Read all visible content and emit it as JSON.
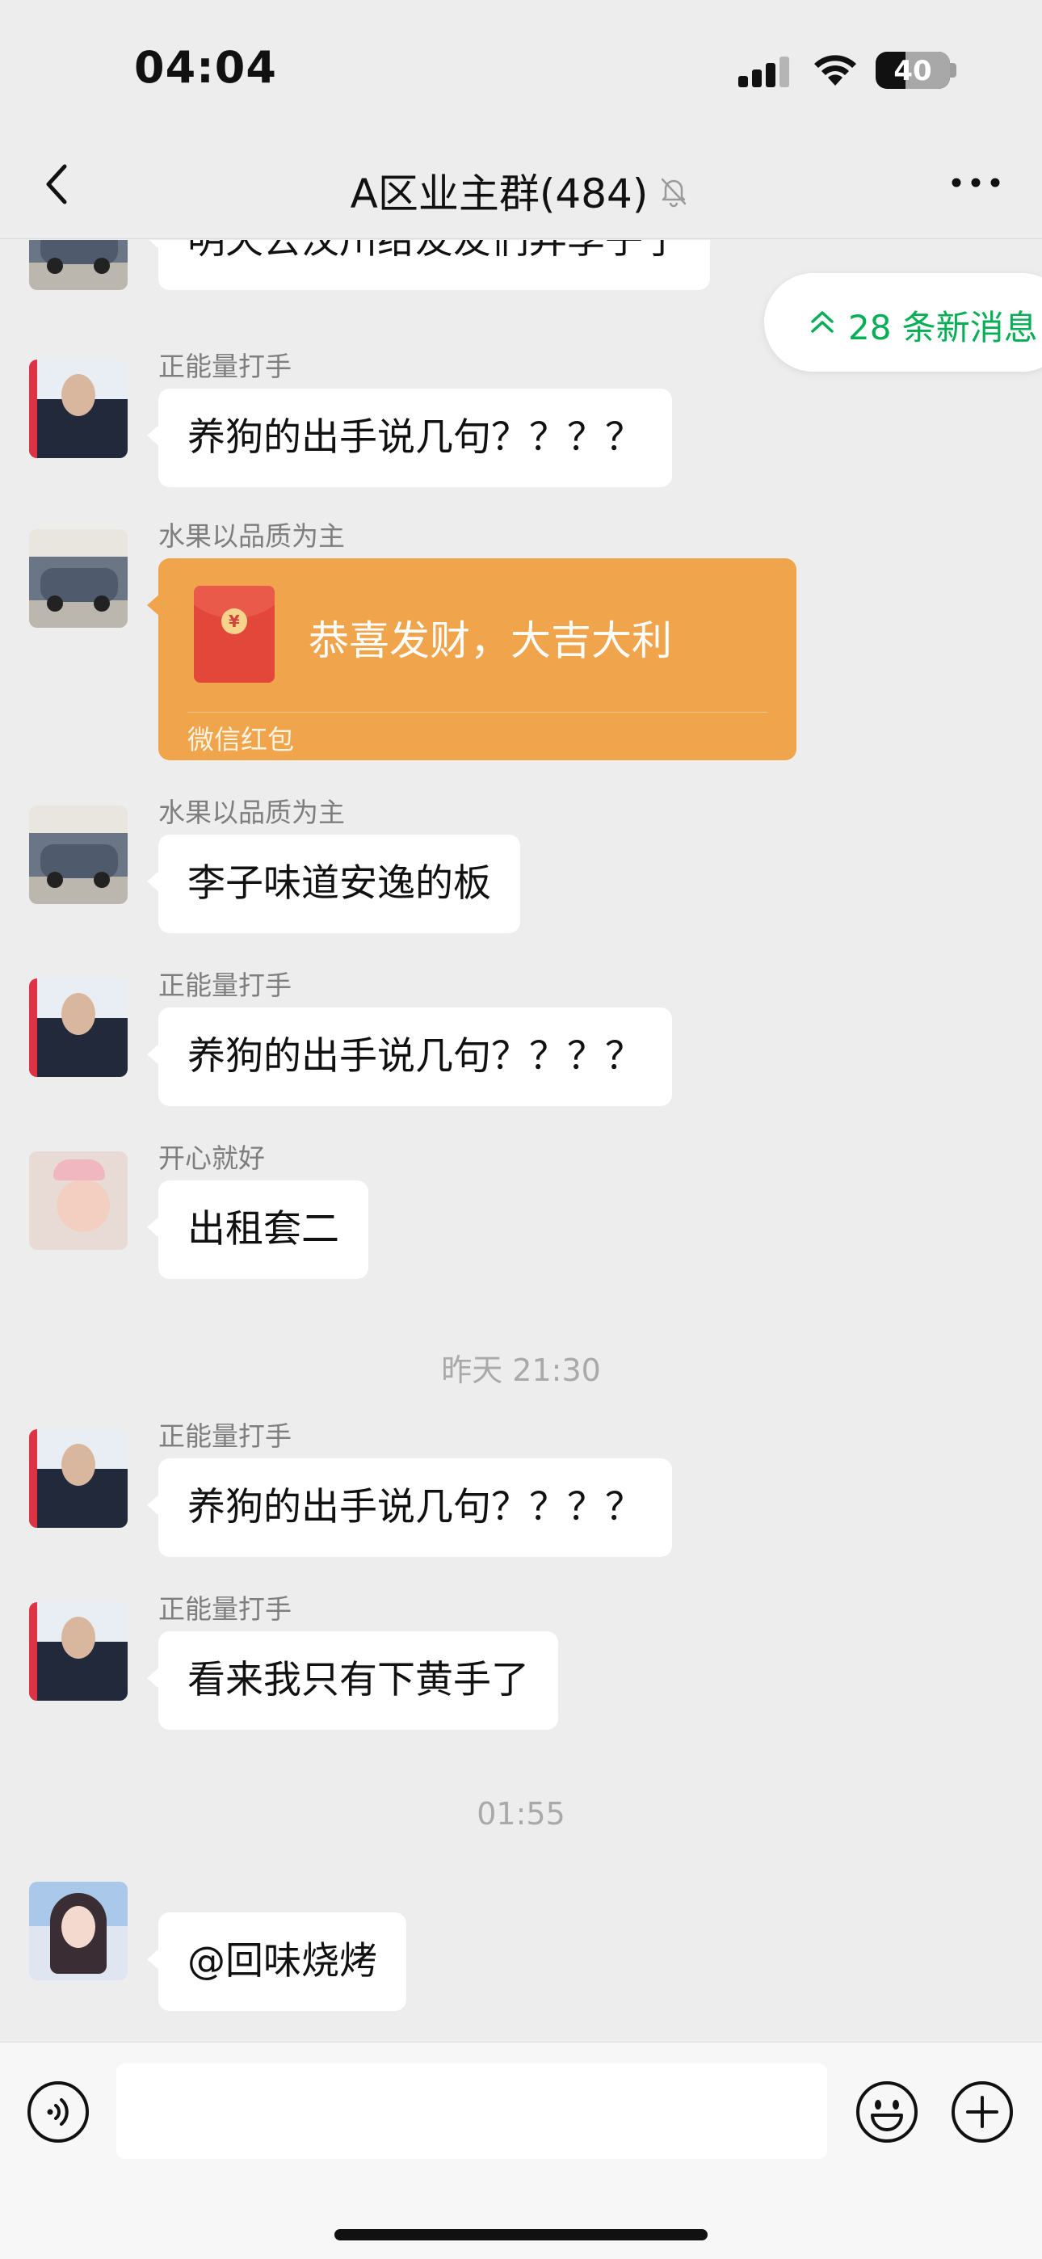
{
  "status_bar": {
    "time": "04:04",
    "battery_level": "40",
    "battery_fraction": 0.4
  },
  "nav": {
    "title": "A区业主群(484)",
    "back_icon": "chevron-left-icon",
    "mute_icon": "bell-slash-icon",
    "more_icon": "more-dots-icon"
  },
  "new_messages": {
    "label": "28 条新消息",
    "icon": "double-chevron-up-icon",
    "color": "#06ae56"
  },
  "messages": [
    {
      "type": "text",
      "sender": "",
      "avatar": "car-photo",
      "text": "明天去汶川给友友们弄李子了"
    },
    {
      "type": "text",
      "sender": "正能量打手",
      "avatar": "man-portrait",
      "text": "养狗的出手说几句？？？？"
    },
    {
      "type": "red_packet",
      "sender": "水果以品质为主",
      "avatar": "car-photo",
      "title": "恭喜发财，大吉大利",
      "label": "微信红包",
      "color": "#f0a44c"
    },
    {
      "type": "text",
      "sender": "水果以品质为主",
      "avatar": "car-photo",
      "text": "李子味道安逸的板"
    },
    {
      "type": "text",
      "sender": "正能量打手",
      "avatar": "man-portrait",
      "text": "养狗的出手说几句？？？？"
    },
    {
      "type": "text",
      "sender": "开心就好",
      "avatar": "baby-photo",
      "text": "出租套二"
    },
    {
      "type": "timestamp",
      "text": "昨天 21:30"
    },
    {
      "type": "text",
      "sender": "正能量打手",
      "avatar": "man-portrait",
      "text": "养狗的出手说几句？？？？"
    },
    {
      "type": "text",
      "sender": "正能量打手",
      "avatar": "man-portrait",
      "text": "看来我只有下黄手了"
    },
    {
      "type": "timestamp",
      "text": "01:55"
    },
    {
      "type": "text",
      "sender": "",
      "avatar": "girl-illustration",
      "text": "@回味烧烤"
    }
  ],
  "input_bar": {
    "voice_icon": "voice-icon",
    "input_value": "",
    "emoji_icon": "smiley-icon",
    "plus_icon": "plus-circle-icon"
  }
}
